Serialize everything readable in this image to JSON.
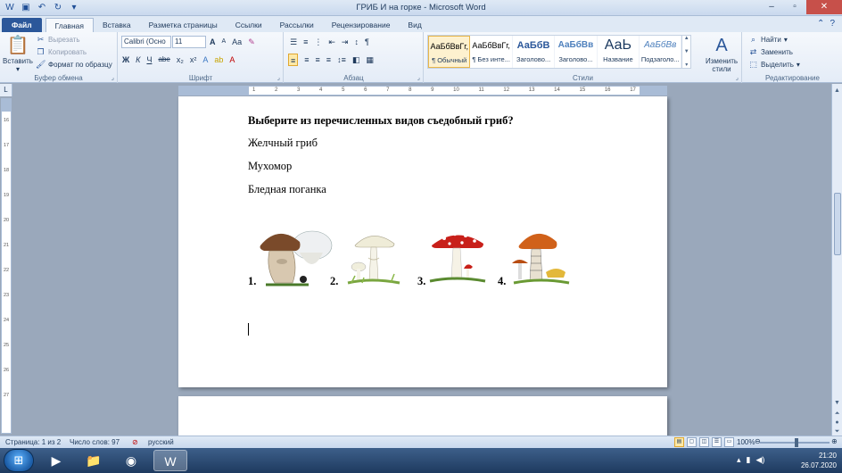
{
  "window": {
    "title": "ГРИБ И на горке - Microsoft Word"
  },
  "tabs": [
    {
      "label": "Файл"
    },
    {
      "label": "Главная"
    },
    {
      "label": "Вставка"
    },
    {
      "label": "Разметка страницы"
    },
    {
      "label": "Ссылки"
    },
    {
      "label": "Рассылки"
    },
    {
      "label": "Рецензирование"
    },
    {
      "label": "Вид"
    }
  ],
  "ribbon": {
    "clipboard": {
      "paste": "Вставить",
      "cut": "Вырезать",
      "copy": "Копировать",
      "format_painter": "Формат по образцу",
      "group": "Буфер обмена"
    },
    "font": {
      "name": "Calibri (Осно",
      "size": "11",
      "bold": "Ж",
      "italic": "К",
      "underline": "Ч",
      "strike": "abe",
      "subscript": "x₂",
      "superscript": "x²",
      "grow": "A",
      "shrink": "A",
      "case": "Aa",
      "group": "Шрифт"
    },
    "paragraph": {
      "group": "Абзац"
    },
    "styles": {
      "items": [
        {
          "sample": "АаБбВвГг,",
          "name": "¶ Обычный"
        },
        {
          "sample": "АаБбВвГг,",
          "name": "¶ Без инте..."
        },
        {
          "sample": "АаБбВ",
          "name": "Заголово..."
        },
        {
          "sample": "АаБбВв",
          "name": "Заголово..."
        },
        {
          "sample": "АаЬ",
          "name": "Название"
        },
        {
          "sample": "АаБбВв",
          "name": "Подзаголо..."
        }
      ],
      "change": "Изменить стили",
      "group": "Стили"
    },
    "editing": {
      "find": "Найти",
      "replace": "Заменить",
      "select": "Выделить",
      "group": "Редактирование"
    }
  },
  "ruler": {
    "h_ticks": [
      "1",
      "2",
      "1",
      "2",
      "3",
      "4",
      "5",
      "6",
      "7",
      "8",
      "9",
      "10",
      "11",
      "12",
      "13",
      "14",
      "15",
      "16",
      "17"
    ],
    "v_ticks": [
      "16",
      "17",
      "18",
      "19",
      "20",
      "21",
      "22",
      "23",
      "24",
      "25",
      "26",
      "27"
    ]
  },
  "document": {
    "question": "Выберите из перечисленных видов съедобный гриб?",
    "answers": [
      "Желчный гриб",
      "Мухомор",
      "Бледная поганка"
    ],
    "numbers": [
      "1.",
      "2.",
      "3.",
      "4."
    ]
  },
  "status": {
    "page": "Страница: 1 из 2",
    "words": "Число слов: 97",
    "language": "русский",
    "zoom": "100%"
  },
  "taskbar": {
    "time": "21:20",
    "date": "26.07.2020"
  },
  "colors": {
    "file_tab": "#2b579a",
    "ribbon_bg": "#e4ecf7",
    "taskbar": "#1e3a5f"
  }
}
